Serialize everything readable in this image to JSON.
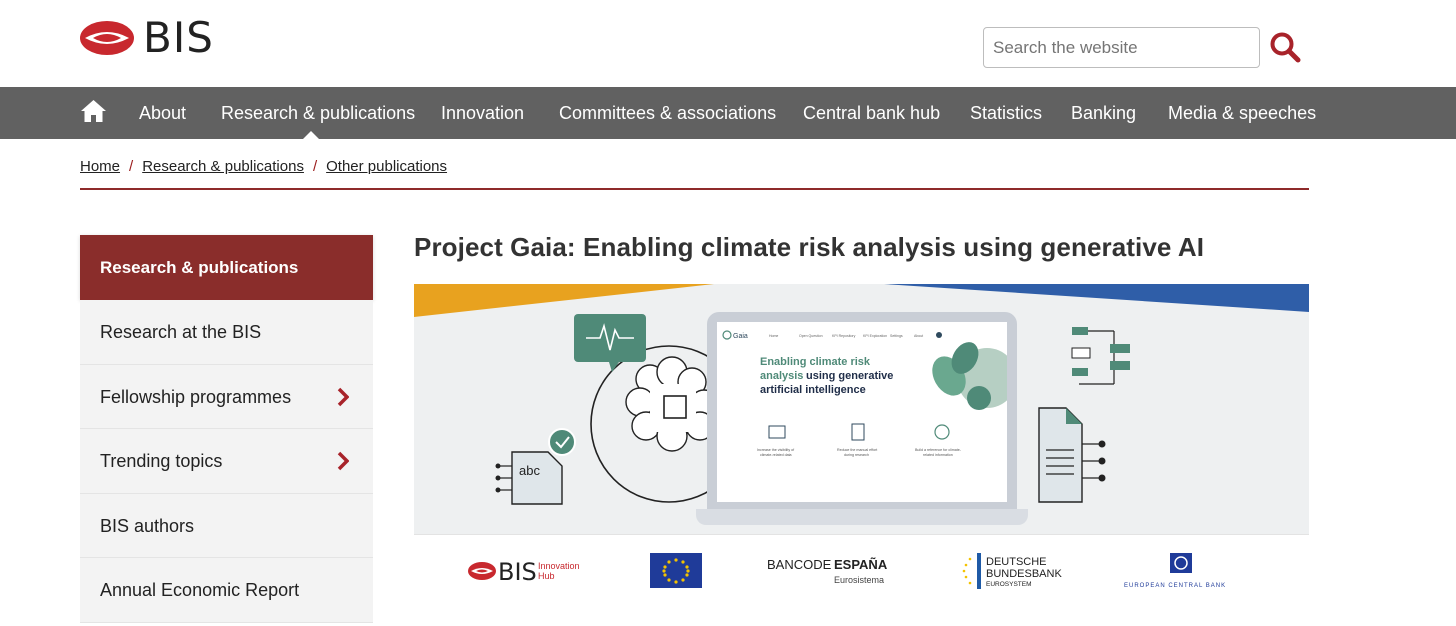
{
  "brand": {
    "logo_text": "BIS"
  },
  "search": {
    "placeholder": "Search the website"
  },
  "nav": {
    "items": [
      "About",
      "Research & publications",
      "Innovation",
      "Committees & associations",
      "Central bank hub",
      "Statistics",
      "Banking",
      "Media & speeches"
    ]
  },
  "breadcrumb": [
    "Home",
    "Research & publications",
    "Other publications"
  ],
  "breadcrumb_separator": "/",
  "sidebar": {
    "heading": "Research & publications",
    "items": [
      {
        "label": "Research at the BIS",
        "has_children": false
      },
      {
        "label": "Fellowship programmes",
        "has_children": true
      },
      {
        "label": "Trending topics",
        "has_children": true
      },
      {
        "label": "BIS authors",
        "has_children": false
      },
      {
        "label": "Annual Economic Report",
        "has_children": false
      }
    ]
  },
  "page": {
    "title": "Project Gaia: Enabling climate risk analysis using generative AI"
  },
  "hero": {
    "screen_brand": "Gaia",
    "screen_nav": [
      "Home",
      "Open Question",
      "KPI Repository",
      "KPI Exploration",
      "Settings",
      "About"
    ],
    "screen_headline_1": "Enabling climate risk",
    "screen_headline_2a": "analysis",
    "screen_headline_2b": " using generative",
    "screen_headline_3": "artificial intelligence",
    "features": [
      {
        "line1": "Increase the visibility of",
        "line2": "climate-related data"
      },
      {
        "line1": "Reduce the manual effort",
        "line2": "during research"
      },
      {
        "line1": "Build a reference for climate-",
        "line2": "related information"
      }
    ],
    "doc_text": "abc",
    "partner_logos": {
      "bis_text": "BIS",
      "bis_sub1": "Innovation",
      "bis_sub2": "Hub",
      "bde_line1": "BANCODE",
      "bde_line1b": "ESPAÑA",
      "bde_line2": "Eurosistema",
      "bundesbank_1": "DEUTSCHE",
      "bundesbank_2": "BUNDESBANK",
      "bundesbank_3": "EUROSYSTEM",
      "ecb": "EUROPEAN CENTRAL BANK"
    }
  },
  "colors": {
    "brand_red": "#8a2d2b",
    "nav_grey": "#616161",
    "sidebar_bg": "#f3f3f3",
    "gaia_green": "#4f8a78",
    "hero_orange": "#e8a21f",
    "hero_blue": "#2f5ea8"
  }
}
